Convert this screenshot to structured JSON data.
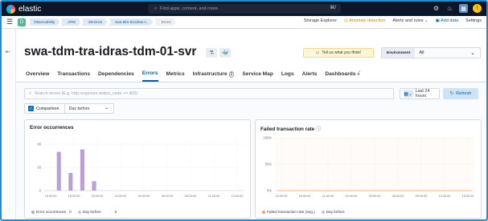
{
  "header": {
    "logo_text": "elastic",
    "search_placeholder": "Find apps, content, and more.",
    "search_shortcut": "⌘/",
    "icons": [
      "help-icon",
      "newsfeed-icon",
      "user-avatar",
      "notification-icon"
    ]
  },
  "breadcrumbs": {
    "space_initial": "D",
    "items": [
      "Observability",
      "APM",
      "Services",
      "swa-tdm-tra-idras-t...",
      "Errors"
    ],
    "right_links": {
      "storage_explorer": "Storage Explorer",
      "anomaly_detection": "Anomaly detection",
      "alerts_rules": "Alerts and rules",
      "add_data": "Add data",
      "settings": "Settings"
    }
  },
  "page": {
    "title": "swa-tdm-tra-idras-tdm-01-svr",
    "feedback_label": "Tell us what you think!",
    "environment_label": "Environment",
    "environment_value": "All",
    "tabs": [
      {
        "label": "Overview",
        "active": false
      },
      {
        "label": "Transactions",
        "active": false
      },
      {
        "label": "Dependencies",
        "active": false
      },
      {
        "label": "Errors",
        "active": true
      },
      {
        "label": "Metrics",
        "active": false
      },
      {
        "label": "Infrastructure",
        "active": false
      },
      {
        "label": "Service Map",
        "active": false
      },
      {
        "label": "Logs",
        "active": false
      },
      {
        "label": "Alerts",
        "active": false
      },
      {
        "label": "Dashboards",
        "active": false
      }
    ]
  },
  "filters": {
    "search_placeholder": "Search errors (E.g. http.response.status_code >= 400)",
    "date_range": "Last 24 hours",
    "refresh_label": "Refresh",
    "comparison_label": "Comparison",
    "comparison_value": "Day before"
  },
  "colors": {
    "primary": "#0061a6",
    "error_series": "#b9a1d6",
    "failed_series": "#f5a35c",
    "header_bg": "#0b1628"
  },
  "chart_data": [
    {
      "type": "bar",
      "title": "Error occurrences",
      "y_ticks": [
        "40",
        "20",
        "0"
      ],
      "ylim": [
        0,
        45
      ],
      "x_ticks": [
        "15:30:00",
        "18:00:00",
        "20:00:00",
        "22:00:00",
        "02:00:00",
        "06:00:00",
        "08:15:00",
        "11:00:00",
        "13:40:00"
      ],
      "series": [
        {
          "name": "Error occurrences",
          "color": "#b9a1d6",
          "values": [
            0,
            0,
            33,
            0,
            15,
            0,
            35,
            0,
            8,
            0,
            0,
            0,
            0,
            0,
            0,
            0,
            0,
            0,
            0,
            0,
            0,
            0,
            0,
            0,
            0,
            0,
            0,
            0,
            0,
            0,
            0,
            0,
            0,
            0
          ]
        }
      ],
      "legend": [
        {
          "label": "Error occurrences",
          "value": "0"
        },
        {
          "label": "Day before",
          "value": "0"
        }
      ]
    },
    {
      "type": "line",
      "title": "Failed transaction rate",
      "y_ticks": [
        "100%",
        "50%",
        "0%"
      ],
      "ylim": [
        0,
        100
      ],
      "x_ticks": [
        "15:00:00",
        "18:00:00",
        "21:00:00",
        "00:00:00",
        "03:00:00",
        "06:00:00",
        "09:00:00",
        "12:00:00",
        "15:00:00"
      ],
      "series": [
        {
          "name": "Failed transaction rate (avg.)",
          "color": "#f5a35c",
          "values": [
            0,
            0,
            0,
            0,
            0,
            0,
            0,
            0,
            0,
            0,
            0,
            0,
            0,
            0,
            0,
            0,
            0,
            0,
            0,
            0,
            0,
            0,
            0,
            0,
            0,
            0,
            0,
            0,
            0,
            0,
            0,
            0,
            0,
            0
          ]
        }
      ],
      "legend": [
        {
          "label": "Failed transaction rate (avg.)"
        },
        {
          "label": "Day before"
        }
      ]
    }
  ]
}
